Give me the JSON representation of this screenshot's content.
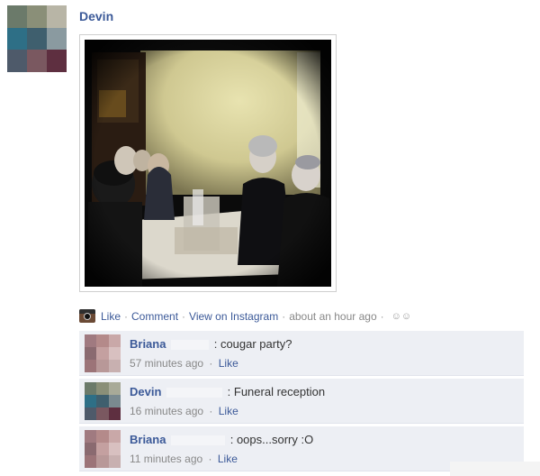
{
  "post": {
    "author": "Devin",
    "avatar_colors": [
      "#6b7a6a",
      "#8a8f78",
      "#b8b5a6",
      "#2e6f86",
      "#3f5f6e",
      "#8a9aa0",
      "#4e5a6a",
      "#7a5860",
      "#5e2f40"
    ],
    "actions": {
      "like": "Like",
      "comment": "Comment",
      "view_on": "View on Instagram",
      "time": "about an hour ago",
      "separator": "·"
    }
  },
  "comments": [
    {
      "author": "Briana",
      "text": ": cougar party?",
      "time": "57 minutes ago",
      "like": "Like",
      "avatar_colors": [
        "#a07a80",
        "#b48a8a",
        "#c9a8a8",
        "#8a6a70",
        "#c4a0a0",
        "#d8c0c0",
        "#9c7478",
        "#b89898",
        "#c8b0b0"
      ]
    },
    {
      "author": "Devin",
      "text": ": Funeral reception",
      "time": "16 minutes ago",
      "like": "Like",
      "avatar_colors": [
        "#6b7a6a",
        "#8a8f78",
        "#a8aa98",
        "#2e6f86",
        "#3f5f6e",
        "#7a8a90",
        "#4e5a6a",
        "#7a5860",
        "#5e2f40"
      ]
    },
    {
      "author": "Briana",
      "text": ": oops...sorry :O",
      "time": "11 minutes ago",
      "like": "Like",
      "avatar_colors": [
        "#a07a80",
        "#b48a8a",
        "#c9a8a8",
        "#8a6a70",
        "#c4a0a0",
        "#d8c0c0",
        "#9c7478",
        "#b89898",
        "#c8b0b0"
      ]
    }
  ],
  "colors": {
    "link": "#3b5998",
    "comment_bg": "#edeff4",
    "meta": "#888888"
  }
}
